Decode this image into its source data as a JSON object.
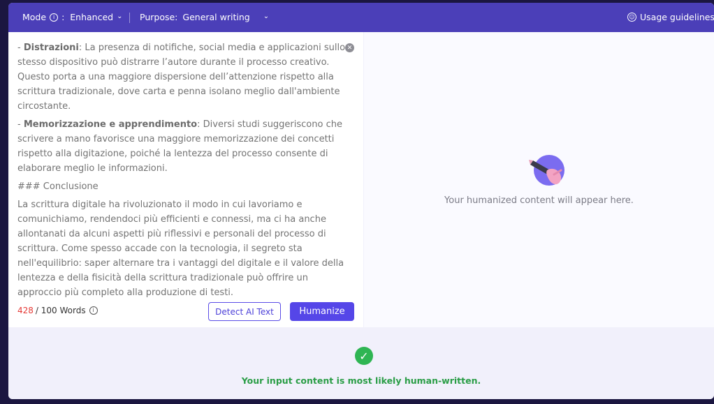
{
  "topbar": {
    "mode_label": "Mode",
    "mode_value": "Enhanced",
    "purpose_label": "Purpose:",
    "purpose_value": "General writing",
    "guidelines_label": "Usage guidelines"
  },
  "editor": {
    "paragraphs": [
      {
        "bold": "Distrazioni",
        "rest": ": La presenza di notifiche, social media e applicazioni sullo stesso dispositivo può distrarre l’autore durante il processo creativo. Questo porta a una maggiore dispersione dell’attenzione rispetto alla scrittura tradizionale, dove carta e penna isolano meglio dall'ambiente circostante.",
        "prefix": "- "
      },
      {
        "bold": "Memorizzazione e apprendimento",
        "rest": ": Diversi studi suggeriscono che scrivere a mano favorisce una maggiore memorizzazione dei concetti rispetto alla digitazione, poiché la lentezza del processo consente di elaborare meglio le informazioni.",
        "prefix": "- "
      },
      {
        "bold": "",
        "rest": "### Conclusione",
        "prefix": ""
      },
      {
        "bold": "",
        "rest": "La scrittura digitale ha rivoluzionato il modo in cui lavoriamo e comunichiamo, rendendoci più efficienti e connessi, ma ci ha anche allontanati da alcuni aspetti più riflessivi e personali del processo di scrittura. Come spesso accade con la tecnologia, il segreto sta nell'equilibrio: saper alternare tra i vantaggi del digitale e il valore della lentezza e della fisicità della scrittura tradizionale può offrire un approccio più completo alla produzione di testi.",
        "prefix": ""
      }
    ],
    "word_count": "428",
    "word_limit": "/ 100 Words",
    "detect_label": "Detect AI Text",
    "humanize_label": "Humanize"
  },
  "output": {
    "placeholder": "Your humanized content will appear here."
  },
  "result": {
    "message": "Your input content is most likely human-written."
  },
  "colors": {
    "topbar": "#4b3fb8",
    "accent": "#5546e8",
    "success": "#2fb553",
    "count_over": "#e53935"
  }
}
